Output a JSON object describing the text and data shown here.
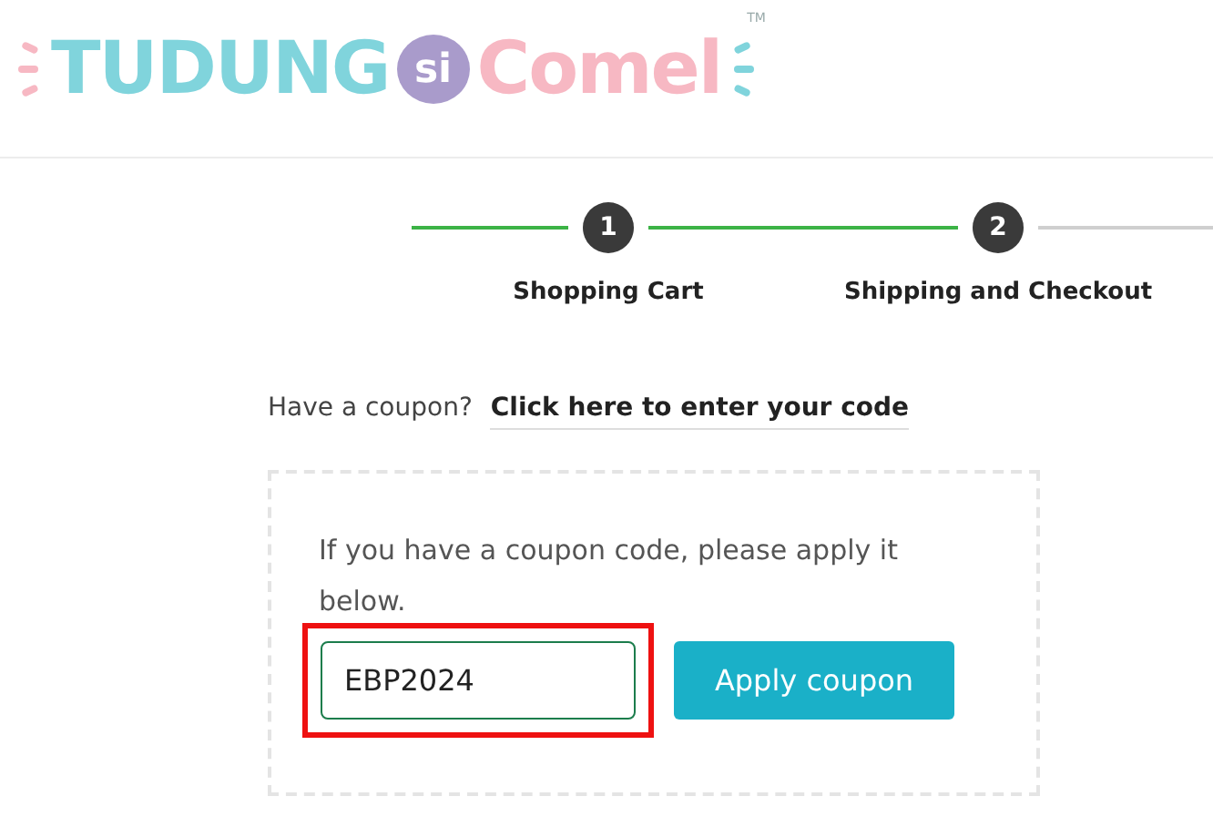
{
  "logo": {
    "word_1": "TUDUNG",
    "word_2": "si",
    "word_3": "Comel",
    "trademark": "TM"
  },
  "steps": [
    {
      "number": "1",
      "label": "Shopping Cart",
      "reached": true
    },
    {
      "number": "2",
      "label": "Shipping and Checkout",
      "reached": true
    }
  ],
  "connectors": [
    {
      "done": true
    },
    {
      "done": true
    },
    {
      "done": false
    }
  ],
  "coupon": {
    "prompt": "Have a coupon?",
    "link": "Click here to enter your code",
    "instructions": "If you have a coupon code, please apply it below.",
    "input": {
      "value": "EBP2024",
      "highlighted": true
    },
    "button": "Apply coupon"
  }
}
